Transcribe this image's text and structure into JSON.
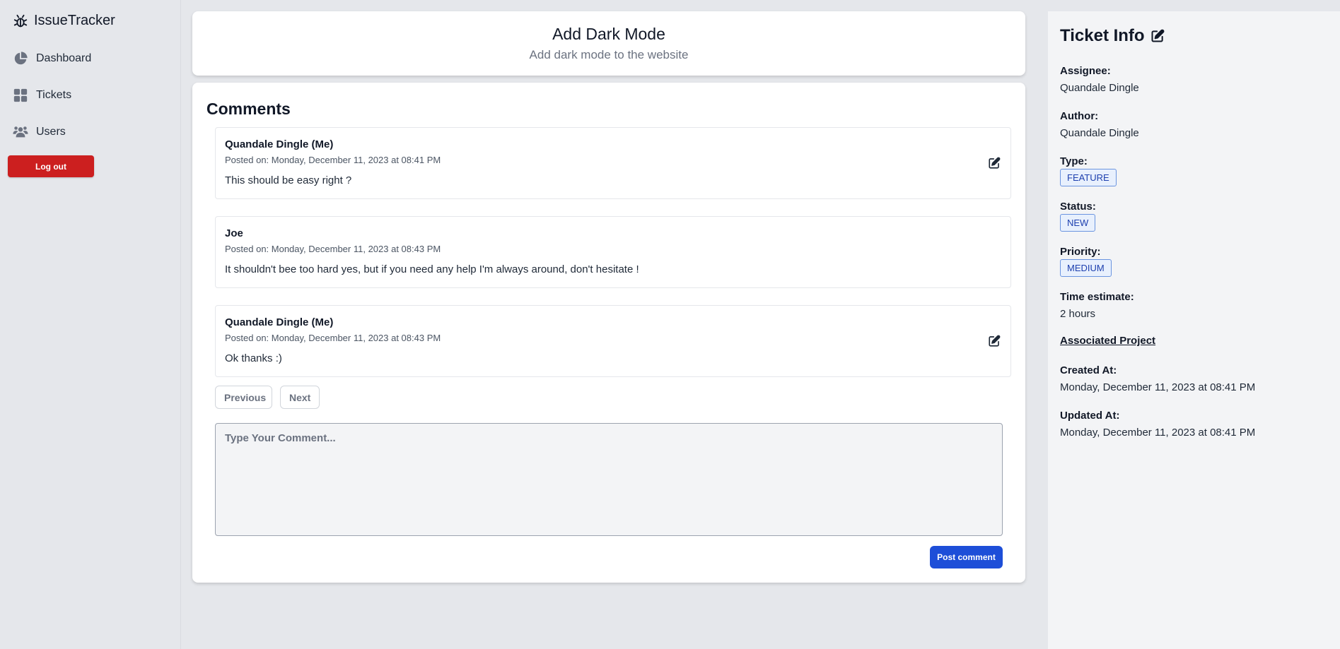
{
  "app": {
    "name": "IssueTracker"
  },
  "sidebar": {
    "items": [
      {
        "label": "Dashboard",
        "icon": "pie-chart-icon"
      },
      {
        "label": "Tickets",
        "icon": "grid-icon"
      },
      {
        "label": "Users",
        "icon": "users-icon"
      }
    ],
    "logout_label": "Log out"
  },
  "ticket": {
    "title": "Add Dark Mode",
    "description": "Add dark mode to the website"
  },
  "comments": {
    "heading": "Comments",
    "items": [
      {
        "author": "Quandale Dingle (Me)",
        "posted": "Posted on: Monday, December 11, 2023 at 08:41 PM",
        "body": "This should be easy right ?",
        "editable": true
      },
      {
        "author": "Joe",
        "posted": "Posted on: Monday, December 11, 2023 at 08:43 PM",
        "body": "It shouldn't bee too hard yes, but if you need any help I'm always around, don't hesitate !",
        "editable": false
      },
      {
        "author": "Quandale Dingle (Me)",
        "posted": "Posted on: Monday, December 11, 2023 at 08:43 PM",
        "body": "Ok thanks :)",
        "editable": true
      }
    ],
    "previous_label": "Previous",
    "next_label": "Next",
    "input_placeholder": "Type Your Comment...",
    "post_label": "Post comment"
  },
  "info": {
    "title": "Ticket Info",
    "assignee_label": "Assignee:",
    "assignee": "Quandale Dingle",
    "author_label": "Author:",
    "author": "Quandale Dingle",
    "type_label": "Type:",
    "type": "FEATURE",
    "status_label": "Status:",
    "status": "NEW",
    "priority_label": "Priority:",
    "priority": "MEDIUM",
    "time_label": "Time estimate:",
    "time": "2 hours",
    "project_label": "Associated Project",
    "created_label": "Created At:",
    "created": "Monday, December 11, 2023 at 08:41 PM",
    "updated_label": "Updated At:",
    "updated": "Monday, December 11, 2023 at 08:41 PM"
  },
  "colors": {
    "logout": "#cc1f1f",
    "primary": "#1d4ed8",
    "badge_border": "#6a94e0",
    "badge_bg": "#e8f0fd"
  }
}
